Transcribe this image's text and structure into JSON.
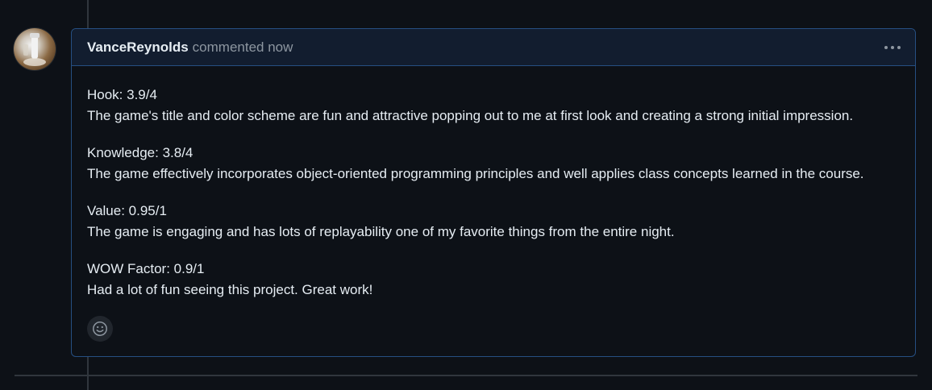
{
  "comment": {
    "author": "VanceReynolds",
    "meta": "commented now",
    "sections": [
      {
        "heading": "Hook: 3.9/4",
        "text": "The game's title and color scheme are fun and attractive popping out to me at first look and creating a strong initial impression."
      },
      {
        "heading": "Knowledge: 3.8/4",
        "text": "The game effectively incorporates object-oriented programming principles and well applies class concepts learned in the course."
      },
      {
        "heading": "Value: 0.95/1",
        "text": "The game is engaging and has lots of replayability one of my favorite things from the entire night."
      },
      {
        "heading": "WOW Factor: 0.9/1",
        "text": "Had a lot of fun seeing this project. Great work!"
      }
    ]
  },
  "icons": {
    "more": "kebab-horizontal-icon",
    "reaction": "smiley-icon"
  },
  "colors": {
    "background": "#0d1117",
    "header_background": "#121d2f",
    "border_accent": "#264f82",
    "muted_text": "#8d96a0",
    "text": "#e6edf3"
  }
}
